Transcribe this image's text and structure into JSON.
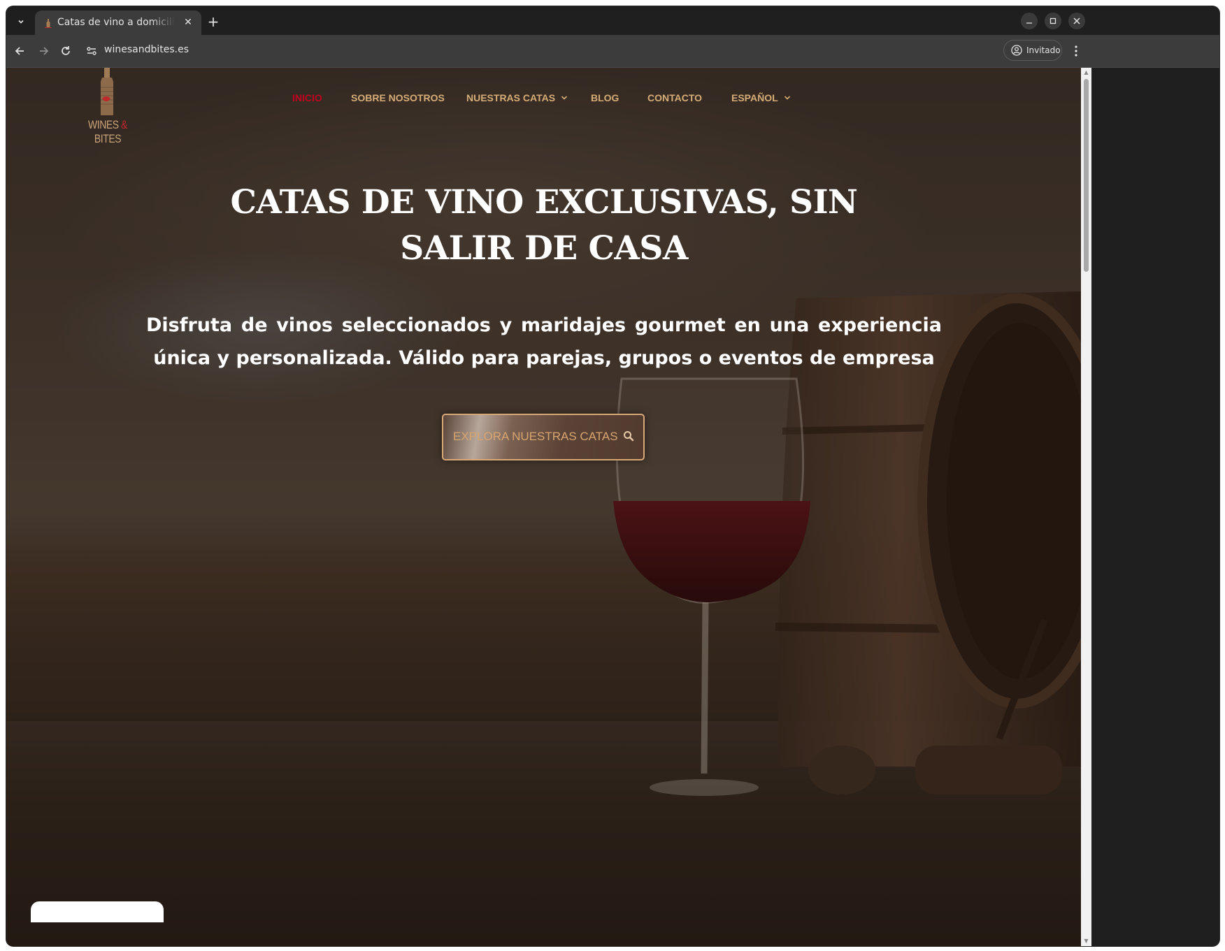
{
  "browser": {
    "tab_title": "Catas de vino a domicilio",
    "tab_close": "✕",
    "new_tab": "+",
    "url": "winesandbites.es",
    "profile_label": "Invitado"
  },
  "site": {
    "logo_text_left": "WINES",
    "logo_text_amp": "&",
    "logo_text_right": "BITES",
    "menu": [
      {
        "label": "INICIO",
        "active": true
      },
      {
        "label": "SOBRE NOSOTROS"
      },
      {
        "label": "NUESTRAS CATAS",
        "has_dropdown": true
      },
      {
        "label": "BLOG"
      },
      {
        "label": "CONTACTO"
      },
      {
        "label": "ESPAÑOL",
        "has_dropdown": true
      }
    ],
    "accent_color": "#d6ad78",
    "active_color": "#c1001f"
  },
  "hero": {
    "title": "CATAS DE VINO EXCLUSIVAS, SIN SALIR DE CASA",
    "subtitle": "Disfruta de vinos seleccionados y maridajes gourmet en una experiencia única y personalizada. Válido para parejas, grupos o eventos de empresa",
    "cta_label": "EXPLORA NUESTRAS CATAS",
    "cta_icon": "search-icon"
  }
}
